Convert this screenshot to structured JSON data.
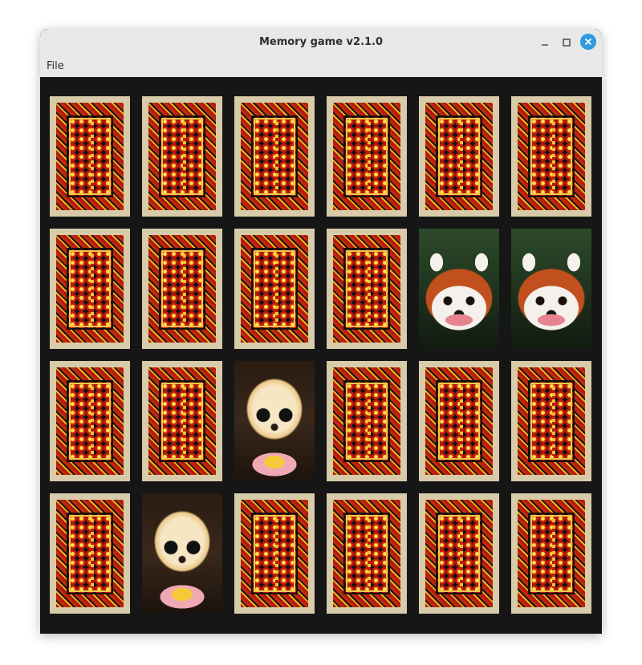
{
  "window": {
    "title": "Memory game v2.1.0",
    "controls": [
      "minimize-icon",
      "maximize-icon",
      "close-icon"
    ]
  },
  "menu": {
    "file_label": "File"
  },
  "board": {
    "rows": 4,
    "cols": 6,
    "cards": [
      [
        "back",
        "back",
        "back",
        "back",
        "back",
        "back"
      ],
      [
        "back",
        "back",
        "back",
        "back",
        "red-panda",
        "red-panda"
      ],
      [
        "back",
        "back",
        "dog",
        "back",
        "back",
        "back"
      ],
      [
        "back",
        "dog",
        "back",
        "back",
        "back",
        "back"
      ]
    ]
  },
  "colors": {
    "board_background": "#161616",
    "titlebar": "#e8e8e8",
    "close_button": "#2f9ade",
    "card_border": "#d8cba9"
  }
}
